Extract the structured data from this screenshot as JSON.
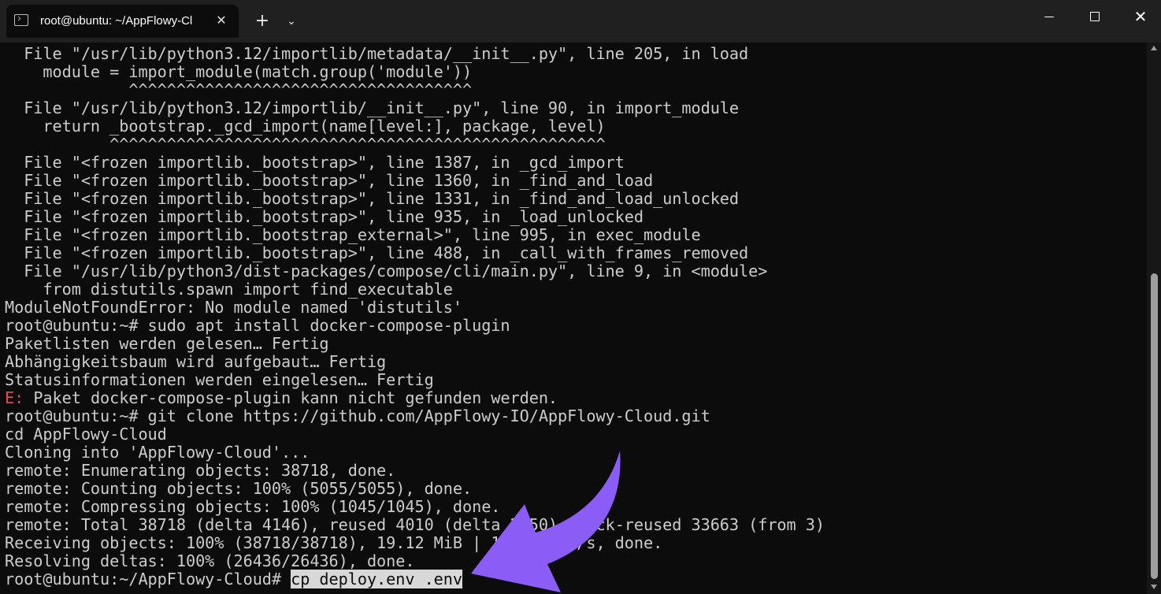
{
  "window": {
    "tab_title": "root@ubuntu: ~/AppFlowy-Cl",
    "close_tab_glyph": "✕",
    "new_tab_glyph": "+",
    "dropdown_glyph": "⌄",
    "close_window_glyph": "✕"
  },
  "terminal": {
    "lines": [
      "  File \"/usr/lib/python3.12/importlib/metadata/__init__.py\", line 205, in load",
      "    module = import_module(match.group('module'))",
      "             ^^^^^^^^^^^^^^^^^^^^^^^^^^^^^^^^^^^^",
      "  File \"/usr/lib/python3.12/importlib/__init__.py\", line 90, in import_module",
      "    return _bootstrap._gcd_import(name[level:], package, level)",
      "           ^^^^^^^^^^^^^^^^^^^^^^^^^^^^^^^^^^^^^^^^^^^^^^^^^^^^",
      "  File \"<frozen importlib._bootstrap>\", line 1387, in _gcd_import",
      "  File \"<frozen importlib._bootstrap>\", line 1360, in _find_and_load",
      "  File \"<frozen importlib._bootstrap>\", line 1331, in _find_and_load_unlocked",
      "  File \"<frozen importlib._bootstrap>\", line 935, in _load_unlocked",
      "  File \"<frozen importlib._bootstrap_external>\", line 995, in exec_module",
      "  File \"<frozen importlib._bootstrap>\", line 488, in _call_with_frames_removed",
      "  File \"/usr/lib/python3/dist-packages/compose/cli/main.py\", line 9, in <module>",
      "    from distutils.spawn import find_executable",
      "ModuleNotFoundError: No module named 'distutils'",
      "root@ubuntu:~# sudo apt install docker-compose-plugin",
      "Paketlisten werden gelesen… Fertig",
      "Abhängigkeitsbaum wird aufgebaut… Fertig",
      "Statusinformationen werden eingelesen… Fertig"
    ],
    "error_prefix": "E:",
    "error_text": " Paket docker-compose-plugin kann nicht gefunden werden.",
    "lines_after": [
      "root@ubuntu:~# git clone https://github.com/AppFlowy-IO/AppFlowy-Cloud.git",
      "cd AppFlowy-Cloud",
      "Cloning into 'AppFlowy-Cloud'...",
      "remote: Enumerating objects: 38718, done.",
      "remote: Counting objects: 100% (5055/5055), done.",
      "remote: Compressing objects: 100% (1045/1045), done.",
      "remote: Total 38718 (delta 4146), reused 4010 (delta 2850), pack-reused 33663 (from 3)",
      "Receiving objects: 100% (38718/38718), 19.12 MiB | 11.57 MiB/s, done.",
      "Resolving deltas: 100% (26436/26436), done."
    ],
    "prompt": "root@ubuntu:~/AppFlowy-Cloud# ",
    "selected_command": "cp deploy.env .env"
  },
  "colors": {
    "background": "#0c0c0c",
    "text": "#cccccc",
    "error": "#e74856",
    "arrow": "#8b5cf6"
  },
  "icons": {
    "tab": "terminal-icon",
    "annotation": "purple-curved-arrow"
  }
}
